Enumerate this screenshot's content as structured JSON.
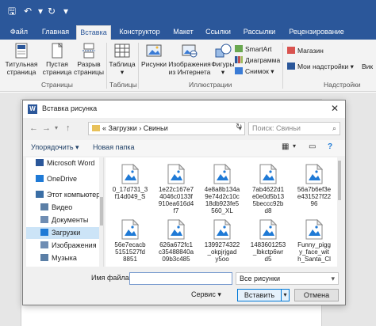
{
  "ribbon_tabs": [
    "Файл",
    "Главная",
    "Вставка",
    "Конструктор",
    "Макет",
    "Ссылки",
    "Рассылки",
    "Рецензирование"
  ],
  "ribbon": {
    "pages_group": {
      "buttons": [
        {
          "line1": "Титульная",
          "line2": "страница"
        },
        {
          "line1": "Пустая",
          "line2": "страница"
        },
        {
          "line1": "Разрыв",
          "line2": "страницы"
        }
      ],
      "label": "Страницы"
    },
    "tables_group": {
      "line1": "Таблица",
      "label": "Таблицы"
    },
    "illustrations_group": {
      "pictures": "Рисунки",
      "online_line1": "Изображения",
      "online_line2": "из Интернета",
      "shapes": "Фигуры",
      "smartart": "SmartArt",
      "chart": "Диаграмма",
      "screenshot": "Снимок",
      "label": "Иллюстрации"
    },
    "addins_group": {
      "store": "Магазин",
      "my_addins": "Мои надстройки",
      "more": "Вик",
      "label": "Надстройки"
    }
  },
  "dialog": {
    "title": "Вставка рисунка",
    "breadcrumb": "« Загрузки › Свиньи",
    "search_placeholder": "Поиск: Свиньи",
    "organize": "Упорядочить ▾",
    "new_folder": "Новая папка",
    "sidebar": [
      {
        "label": "Microsoft Word",
        "icon": "word-icon",
        "color": "#2b579a"
      },
      {
        "label": "OneDrive",
        "icon": "cloud-icon",
        "color": "#1f7ad6"
      },
      {
        "label": "Этот компьютер",
        "icon": "computer-icon",
        "color": "#3a6ea5"
      },
      {
        "label": "Видео",
        "icon": "video-icon",
        "color": "#5b7fa6"
      },
      {
        "label": "Документы",
        "icon": "documents-icon",
        "color": "#6f8db3"
      },
      {
        "label": "Загрузки",
        "icon": "downloads-icon",
        "color": "#1f7ad6",
        "selected": true
      },
      {
        "label": "Изображения",
        "icon": "images-icon",
        "color": "#6f8db3"
      },
      {
        "label": "Музыка",
        "icon": "music-icon",
        "color": "#5b7fa6"
      }
    ],
    "files": [
      {
        "line1": "0_17d731_3",
        "line2": "f14d049_S",
        "line3": ""
      },
      {
        "line1": "1e22c167e7",
        "line2": "4046c0133f",
        "line3": "910ea616d4"
      },
      {
        "line1": "4e8a8b134a",
        "line2": "9e74d2c10c",
        "line3": "18db923fe5"
      },
      {
        "line1": "7ab4622d1",
        "line2": "e0e0d5b13",
        "line3": "5beccc92b"
      },
      {
        "line1": "56a7b6ef3e",
        "line2": "e431527f22",
        "line3": "96"
      },
      {
        "line1": "56e7ecacb",
        "line2": "5151527fd",
        "line3": "8851"
      },
      {
        "line1": "626a672fc1",
        "line2": "c35488840a",
        "line3": "09b3c485"
      },
      {
        "line1": "1399274322",
        "line2": "_okpjrjgad",
        "line3": "y5oo"
      },
      {
        "line1": "1483601253",
        "line2": "_lbkctp6wr",
        "line3": "d5"
      },
      {
        "line1": "Funny_pigg",
        "line2": "y_face_wit",
        "line3": "h_Santa_Cl"
      }
    ],
    "files_extra_label": {
      "index2": "f7",
      "index3": "560_XL",
      "index4": "d8"
    },
    "filename_label": "Имя файла:",
    "filter": "Все рисунки",
    "service": "Сервис ▾",
    "insert": "Вставить",
    "cancel": "Отмена"
  }
}
